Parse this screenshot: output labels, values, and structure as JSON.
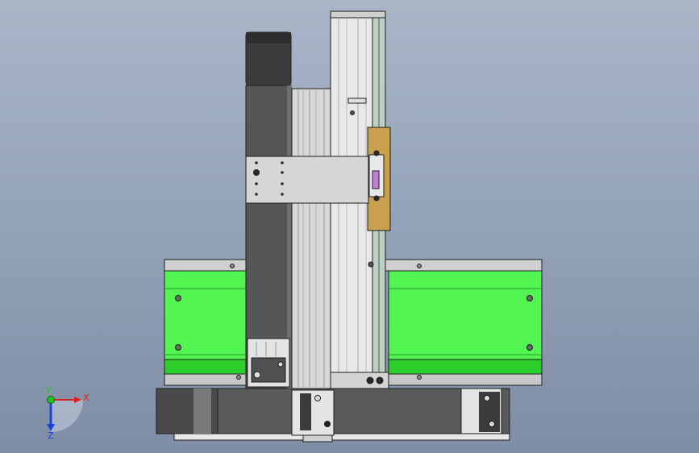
{
  "viewport": {
    "background_top": "#a9b6c8",
    "background_bottom": "#7f8ea6"
  },
  "colors": {
    "green": "#52f552",
    "green_dark": "#2ccf2c",
    "dark_gray": "#505050",
    "mid_gray": "#6e6e6e",
    "light_gray": "#d6d6d6",
    "aluminum": "#e4e4e4",
    "bracket_gold": "#c8a04e",
    "pink": "#c080d8",
    "outline": "#1e1e1e"
  },
  "triad": {
    "x_label": "X",
    "y_label": "Y",
    "z_label": "Z",
    "x_color": "#e02020",
    "y_color": "#20c020",
    "z_color": "#2040e0"
  }
}
